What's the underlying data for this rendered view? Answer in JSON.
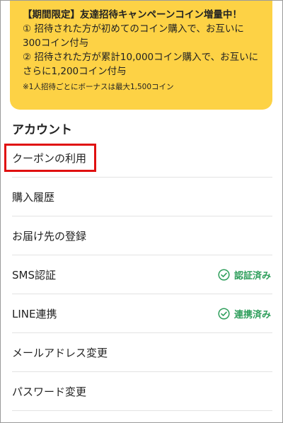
{
  "campaign": {
    "title": "【期間限定】友達招待キャンペーンコイン増量中！",
    "line1a": "① 招待された方が初めてのコイン購入で、お互いに",
    "line1b": "300コイン付与",
    "line2a": "② 招待された方が累計10,000コイン購入で、お互いに",
    "line2b": "さらに1,200コイン付与",
    "note": "※1人招待ごとにボーナスは最大1,500コイン"
  },
  "account": {
    "heading": "アカウント",
    "items": [
      {
        "label": "クーポンの利用"
      },
      {
        "label": "購入履歴"
      },
      {
        "label": "お届け先の登録"
      },
      {
        "label": "SMS認証",
        "status": "認証済み",
        "status_icon": "check-circle-icon"
      },
      {
        "label": "LINE連携",
        "status": "連携済み",
        "status_icon": "check-circle-icon"
      },
      {
        "label": "メールアドレス変更"
      },
      {
        "label": "パスワード変更"
      }
    ]
  },
  "colors": {
    "banner_bg": "#fdd245",
    "status_green": "#2e9e5b",
    "highlight_red": "#e01010"
  }
}
